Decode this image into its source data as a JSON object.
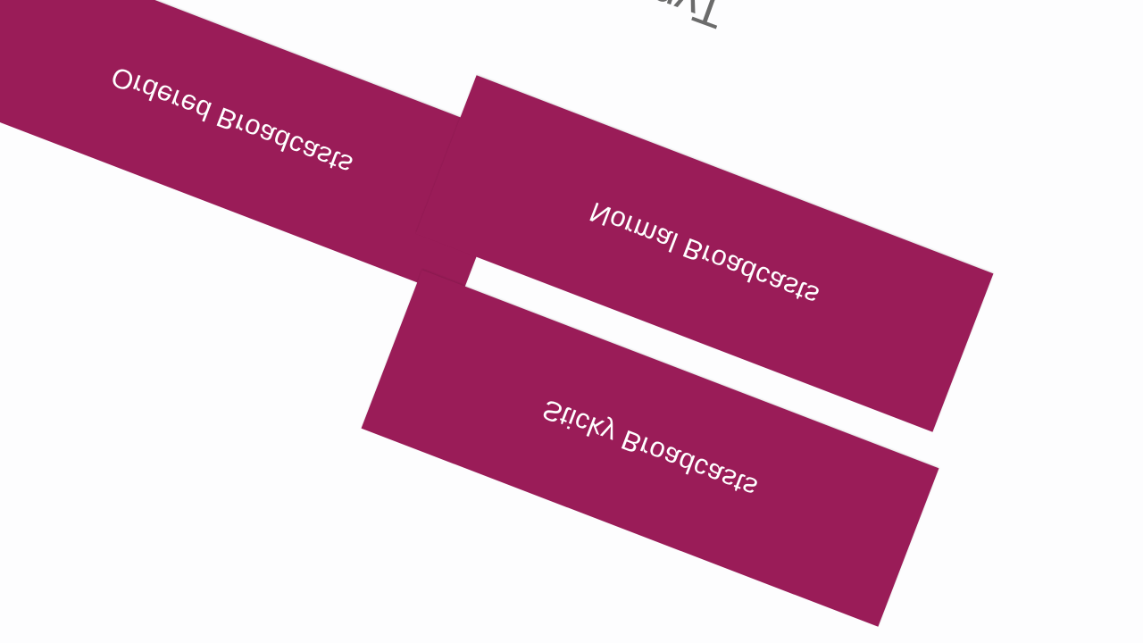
{
  "page": {
    "heading": "Type"
  },
  "cards": {
    "ordered": {
      "label": "Ordered Broadcasts"
    },
    "normal": {
      "label": "Normal Broadcasts"
    },
    "sticky": {
      "label": "Sticky Broadcasts"
    }
  },
  "colors": {
    "card_background": "#9a1c58",
    "card_text": "#ffffff",
    "page_background": "#fdfdfe",
    "heading_text": "#6b6b6b"
  }
}
